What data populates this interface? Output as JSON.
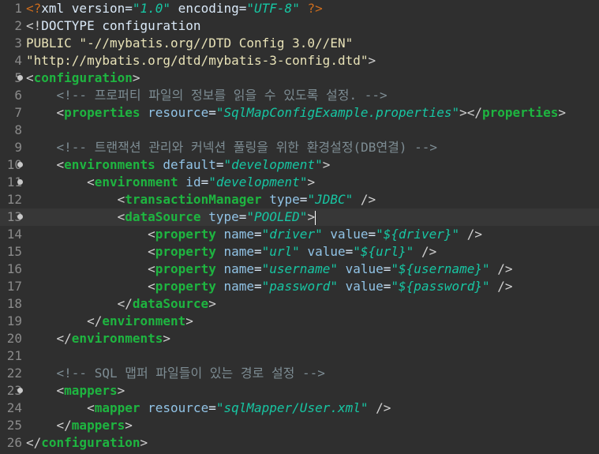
{
  "lines": [
    {
      "num": "1",
      "fold": false,
      "current": false,
      "tokens": [
        {
          "t": "<?",
          "c": "pi"
        },
        {
          "t": "xml ",
          "c": "text"
        },
        {
          "t": "version",
          "c": "text"
        },
        {
          "t": "=",
          "c": "text"
        },
        {
          "t": "\"1.0\"",
          "c": "val"
        },
        {
          "t": " encoding",
          "c": "text"
        },
        {
          "t": "=",
          "c": "text"
        },
        {
          "t": "\"UTF-8\"",
          "c": "val"
        },
        {
          "t": " ?>",
          "c": "pi"
        }
      ]
    },
    {
      "num": "2",
      "fold": false,
      "current": false,
      "tokens": [
        {
          "t": "<!",
          "c": "bracket"
        },
        {
          "t": "DOCTYPE",
          "c": "doctype"
        },
        {
          "t": " configuration",
          "c": "text"
        }
      ]
    },
    {
      "num": "3",
      "fold": false,
      "current": false,
      "tokens": [
        {
          "t": "PUBLIC \"-//mybatis.org//DTD Config 3.0//EN\"",
          "c": "plain"
        }
      ]
    },
    {
      "num": "4",
      "fold": false,
      "current": false,
      "tokens": [
        {
          "t": "\"http://mybatis.org/dtd/mybatis-3-config.dtd\"",
          "c": "plain"
        },
        {
          "t": ">",
          "c": "bracket"
        }
      ]
    },
    {
      "num": "5",
      "fold": true,
      "current": false,
      "tokens": [
        {
          "t": "<",
          "c": "bracket"
        },
        {
          "t": "configuration",
          "c": "tag"
        },
        {
          "t": ">",
          "c": "bracket"
        }
      ]
    },
    {
      "num": "6",
      "fold": false,
      "current": false,
      "tokens": [
        {
          "t": "    <!-- 프로퍼티 파일의 정보를 읽을 수 있도록 설정. -->",
          "c": "comment"
        }
      ]
    },
    {
      "num": "7",
      "fold": false,
      "current": false,
      "tokens": [
        {
          "t": "    <",
          "c": "bracket"
        },
        {
          "t": "properties",
          "c": "tag"
        },
        {
          "t": " resource",
          "c": "attr"
        },
        {
          "t": "=",
          "c": "text"
        },
        {
          "t": "\"SqlMapConfigExample.properties\"",
          "c": "val"
        },
        {
          "t": "></",
          "c": "bracket"
        },
        {
          "t": "properties",
          "c": "tag"
        },
        {
          "t": ">",
          "c": "bracket"
        }
      ]
    },
    {
      "num": "8",
      "fold": false,
      "current": false,
      "tokens": []
    },
    {
      "num": "9",
      "fold": false,
      "current": false,
      "tokens": [
        {
          "t": "    <!-- 트랜잭션 관리와 커넥션 풀링을 위한 환경설정(DB연결) -->",
          "c": "comment"
        }
      ]
    },
    {
      "num": "10",
      "fold": true,
      "current": false,
      "tokens": [
        {
          "t": "    <",
          "c": "bracket"
        },
        {
          "t": "environments",
          "c": "tag"
        },
        {
          "t": " default",
          "c": "attr"
        },
        {
          "t": "=",
          "c": "text"
        },
        {
          "t": "\"development\"",
          "c": "val"
        },
        {
          "t": ">",
          "c": "bracket"
        }
      ]
    },
    {
      "num": "11",
      "fold": true,
      "current": false,
      "tokens": [
        {
          "t": "        <",
          "c": "bracket"
        },
        {
          "t": "environment",
          "c": "tag"
        },
        {
          "t": " id",
          "c": "attr"
        },
        {
          "t": "=",
          "c": "text"
        },
        {
          "t": "\"development\"",
          "c": "val"
        },
        {
          "t": ">",
          "c": "bracket"
        }
      ]
    },
    {
      "num": "12",
      "fold": false,
      "current": false,
      "tokens": [
        {
          "t": "            <",
          "c": "bracket"
        },
        {
          "t": "transactionManager",
          "c": "tag"
        },
        {
          "t": " type",
          "c": "attr"
        },
        {
          "t": "=",
          "c": "text"
        },
        {
          "t": "\"JDBC\"",
          "c": "val"
        },
        {
          "t": " />",
          "c": "bracket"
        }
      ]
    },
    {
      "num": "13",
      "fold": true,
      "current": true,
      "tokens": [
        {
          "t": "            <",
          "c": "bracket"
        },
        {
          "t": "dataSource",
          "c": "tag"
        },
        {
          "t": " type",
          "c": "attr"
        },
        {
          "t": "=",
          "c": "text"
        },
        {
          "t": "\"POOLED\"",
          "c": "val"
        },
        {
          "t": ">",
          "c": "bracket"
        }
      ]
    },
    {
      "num": "14",
      "fold": false,
      "current": false,
      "tokens": [
        {
          "t": "                <",
          "c": "bracket"
        },
        {
          "t": "property",
          "c": "tag"
        },
        {
          "t": " name",
          "c": "attr"
        },
        {
          "t": "=",
          "c": "text"
        },
        {
          "t": "\"driver\"",
          "c": "val"
        },
        {
          "t": " value",
          "c": "attr"
        },
        {
          "t": "=",
          "c": "text"
        },
        {
          "t": "\"${driver}\"",
          "c": "val"
        },
        {
          "t": " />",
          "c": "bracket"
        }
      ]
    },
    {
      "num": "15",
      "fold": false,
      "current": false,
      "tokens": [
        {
          "t": "                <",
          "c": "bracket"
        },
        {
          "t": "property",
          "c": "tag"
        },
        {
          "t": " name",
          "c": "attr"
        },
        {
          "t": "=",
          "c": "text"
        },
        {
          "t": "\"url\"",
          "c": "val"
        },
        {
          "t": " value",
          "c": "attr"
        },
        {
          "t": "=",
          "c": "text"
        },
        {
          "t": "\"${url}\"",
          "c": "val"
        },
        {
          "t": " />",
          "c": "bracket"
        }
      ]
    },
    {
      "num": "16",
      "fold": false,
      "current": false,
      "tokens": [
        {
          "t": "                <",
          "c": "bracket"
        },
        {
          "t": "property",
          "c": "tag"
        },
        {
          "t": " name",
          "c": "attr"
        },
        {
          "t": "=",
          "c": "text"
        },
        {
          "t": "\"username\"",
          "c": "val"
        },
        {
          "t": " value",
          "c": "attr"
        },
        {
          "t": "=",
          "c": "text"
        },
        {
          "t": "\"${username}\"",
          "c": "val"
        },
        {
          "t": " />",
          "c": "bracket"
        }
      ]
    },
    {
      "num": "17",
      "fold": false,
      "current": false,
      "tokens": [
        {
          "t": "                <",
          "c": "bracket"
        },
        {
          "t": "property",
          "c": "tag"
        },
        {
          "t": " name",
          "c": "attr"
        },
        {
          "t": "=",
          "c": "text"
        },
        {
          "t": "\"password\"",
          "c": "val"
        },
        {
          "t": " value",
          "c": "attr"
        },
        {
          "t": "=",
          "c": "text"
        },
        {
          "t": "\"${password}\"",
          "c": "val"
        },
        {
          "t": " />",
          "c": "bracket"
        }
      ]
    },
    {
      "num": "18",
      "fold": false,
      "current": false,
      "tokens": [
        {
          "t": "            </",
          "c": "bracket"
        },
        {
          "t": "dataSource",
          "c": "tag"
        },
        {
          "t": ">",
          "c": "bracket"
        }
      ]
    },
    {
      "num": "19",
      "fold": false,
      "current": false,
      "tokens": [
        {
          "t": "        </",
          "c": "bracket"
        },
        {
          "t": "environment",
          "c": "tag"
        },
        {
          "t": ">",
          "c": "bracket"
        }
      ]
    },
    {
      "num": "20",
      "fold": false,
      "current": false,
      "tokens": [
        {
          "t": "    </",
          "c": "bracket"
        },
        {
          "t": "environments",
          "c": "tag"
        },
        {
          "t": ">",
          "c": "bracket"
        }
      ]
    },
    {
      "num": "21",
      "fold": false,
      "current": false,
      "tokens": []
    },
    {
      "num": "22",
      "fold": false,
      "current": false,
      "tokens": [
        {
          "t": "    <!-- SQL 맵퍼 파일들이 있는 경로 설정 -->",
          "c": "comment"
        }
      ]
    },
    {
      "num": "23",
      "fold": true,
      "current": false,
      "tokens": [
        {
          "t": "    <",
          "c": "bracket"
        },
        {
          "t": "mappers",
          "c": "tag"
        },
        {
          "t": ">",
          "c": "bracket"
        }
      ]
    },
    {
      "num": "24",
      "fold": false,
      "current": false,
      "tokens": [
        {
          "t": "        <",
          "c": "bracket"
        },
        {
          "t": "mapper",
          "c": "tag"
        },
        {
          "t": " resource",
          "c": "attr"
        },
        {
          "t": "=",
          "c": "text"
        },
        {
          "t": "\"sqlMapper/User.xml\"",
          "c": "val"
        },
        {
          "t": " />",
          "c": "bracket"
        }
      ]
    },
    {
      "num": "25",
      "fold": false,
      "current": false,
      "tokens": [
        {
          "t": "    </",
          "c": "bracket"
        },
        {
          "t": "mappers",
          "c": "tag"
        },
        {
          "t": ">",
          "c": "bracket"
        }
      ]
    },
    {
      "num": "26",
      "fold": false,
      "current": false,
      "tokens": [
        {
          "t": "</",
          "c": "bracket"
        },
        {
          "t": "configuration",
          "c": "tag"
        },
        {
          "t": ">",
          "c": "bracket"
        }
      ]
    }
  ]
}
